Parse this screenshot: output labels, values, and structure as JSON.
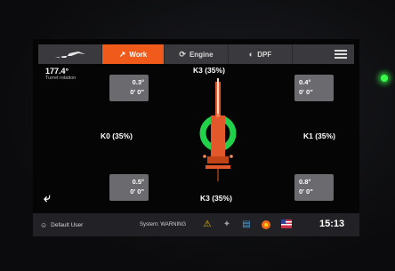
{
  "nav": {
    "tabs": [
      {
        "label": "",
        "icon": "excavator-logo-icon"
      },
      {
        "label": "Work",
        "icon": "work-arm-icon"
      },
      {
        "label": "Engine",
        "icon": "engine-icon"
      },
      {
        "label": "DPF",
        "icon": "dpf-icon"
      }
    ],
    "menu_icon": "hamburger-menu-icon",
    "active_color": "#f05a1a"
  },
  "tilt": {
    "value": "177.4°",
    "label": "Turret rotation"
  },
  "k_labels": {
    "top": "K3 (35%)",
    "bottom": "K3 (35%)",
    "left": "K0 (35%)",
    "right": "K1 (35%)"
  },
  "readouts": {
    "top_left": {
      "deg": "0.3°",
      "dms": "0' 0\""
    },
    "top_right": {
      "deg": "0.4°",
      "dms": "0' 0\""
    },
    "bottom_left": {
      "deg": "0.5°",
      "dms": "0' 0\""
    },
    "bottom_right": {
      "deg": "0.8°",
      "dms": "0' 0\""
    }
  },
  "footer": {
    "user": "Default User",
    "system": "System: WARNING",
    "time": "15:13",
    "icons": [
      "warning-icon",
      "signal-icon",
      "machine-status-icon",
      "alert-circle-icon",
      "flag-icon"
    ]
  },
  "colors": {
    "accent": "#f05a1a",
    "ring": "#22d14a",
    "box": "#6b6b6f"
  }
}
